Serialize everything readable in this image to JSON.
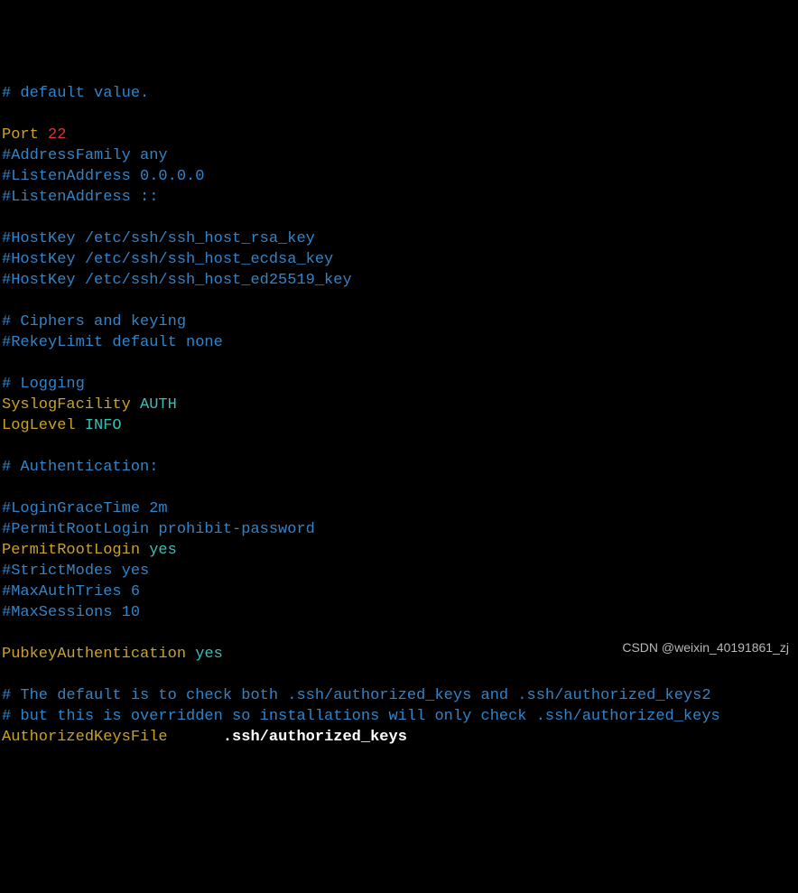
{
  "lines": {
    "l0_comment": "# default value.",
    "l1_key": "Port",
    "l1_val": "22",
    "l2_comment": "#AddressFamily any",
    "l3_comment": "#ListenAddress 0.0.0.0",
    "l4_comment": "#ListenAddress ::",
    "l5_comment": "#HostKey /etc/ssh/ssh_host_rsa_key",
    "l6_comment": "#HostKey /etc/ssh/ssh_host_ecdsa_key",
    "l7_comment": "#HostKey /etc/ssh/ssh_host_ed25519_key",
    "l8_comment": "# Ciphers and keying",
    "l9_comment": "#RekeyLimit default none",
    "l10_comment": "# Logging",
    "l11_key": "SyslogFacility",
    "l11_val": "AUTH",
    "l12_key": "LogLevel",
    "l12_val": "INFO",
    "l13_comment": "# Authentication:",
    "l14_comment": "#LoginGraceTime 2m",
    "l15_comment": "#PermitRootLogin prohibit-password",
    "l16_key": "PermitRootLogin",
    "l16_val": "yes",
    "l17_comment": "#StrictModes yes",
    "l18_comment": "#MaxAuthTries 6",
    "l19_comment": "#MaxSessions 10",
    "l20_key": "PubkeyAuthentication",
    "l20_val": "yes",
    "l21_comment": "# The default is to check both .ssh/authorized_keys and .ssh/authorized_keys2",
    "l22_comment": "# but this is overridden so installations will only check .ssh/authorized_keys",
    "l23_key": "AuthorizedKeysFile",
    "l23_spacer": "      ",
    "l23_val": ".ssh/authorized_keys"
  },
  "watermark": "CSDN @weixin_40191861_zj"
}
